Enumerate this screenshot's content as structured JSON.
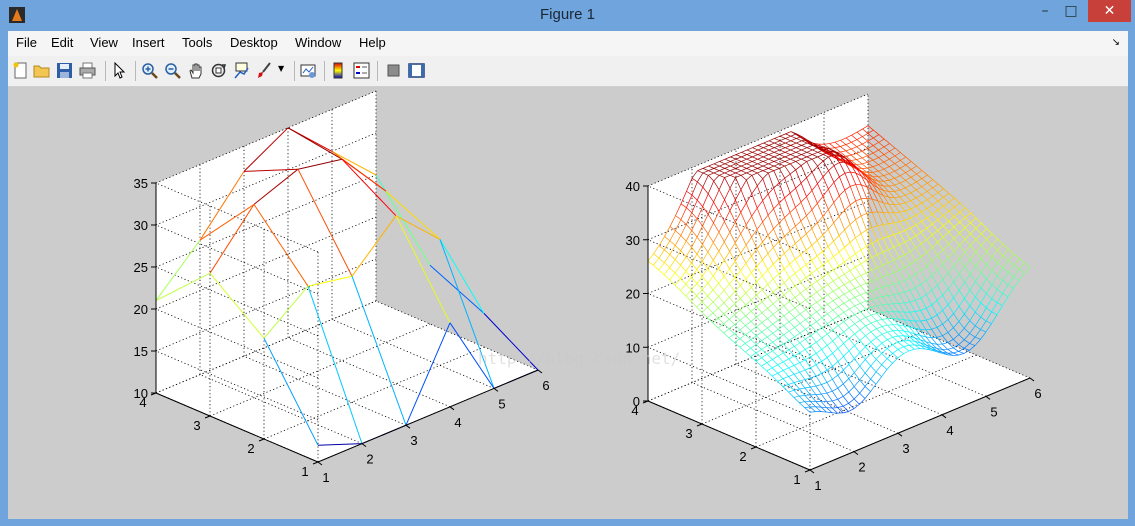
{
  "window": {
    "title": "Figure 1"
  },
  "menu": [
    "File",
    "Edit",
    "View",
    "Insert",
    "Tools",
    "Desktop",
    "Window",
    "Help"
  ],
  "toolbar": {
    "icons": [
      "new-figure-icon",
      "open-file-icon",
      "save-icon",
      "print-icon",
      "pointer-icon",
      "zoom-in-icon",
      "zoom-out-icon",
      "pan-icon",
      "rotate-3d-icon",
      "data-cursor-icon",
      "brush-icon",
      "link-plot-icon",
      "colorbar-icon",
      "legend-icon",
      "hide-plot-tools-icon",
      "show-plot-tools-icon"
    ]
  },
  "watermark": "http://blog.csdn.net/",
  "chart_data": [
    {
      "type": "3d-mesh",
      "x": [
        1,
        2,
        3,
        4,
        5,
        6
      ],
      "y": [
        1,
        2,
        3,
        4
      ],
      "z": [
        [
          12,
          10,
          10,
          20,
          10,
          10
        ],
        [
          22,
          26,
          25,
          30,
          25,
          14
        ],
        [
          27,
          33,
          35,
          34,
          28,
          17
        ],
        [
          21,
          26,
          32,
          35,
          30,
          25
        ]
      ],
      "zlim": [
        10,
        35
      ],
      "xticks": [
        "1",
        "2",
        "3",
        "4",
        "5",
        "6"
      ],
      "yticks": [
        "1",
        "2",
        "3",
        "4"
      ],
      "zticks": [
        "10",
        "15",
        "20",
        "25",
        "30",
        "35"
      ],
      "grid": true,
      "colormap": "jet"
    },
    {
      "type": "3d-mesh-interpolated",
      "x": [
        1,
        2,
        3,
        4,
        5,
        6
      ],
      "y": [
        1,
        2,
        3,
        4
      ],
      "zlim": [
        0,
        40
      ],
      "xticks": [
        "1",
        "2",
        "3",
        "4",
        "5",
        "6"
      ],
      "yticks": [
        "1",
        "2",
        "3",
        "4"
      ],
      "zticks": [
        "0",
        "10",
        "20",
        "30",
        "40"
      ],
      "grid": true,
      "colormap": "jet"
    }
  ]
}
